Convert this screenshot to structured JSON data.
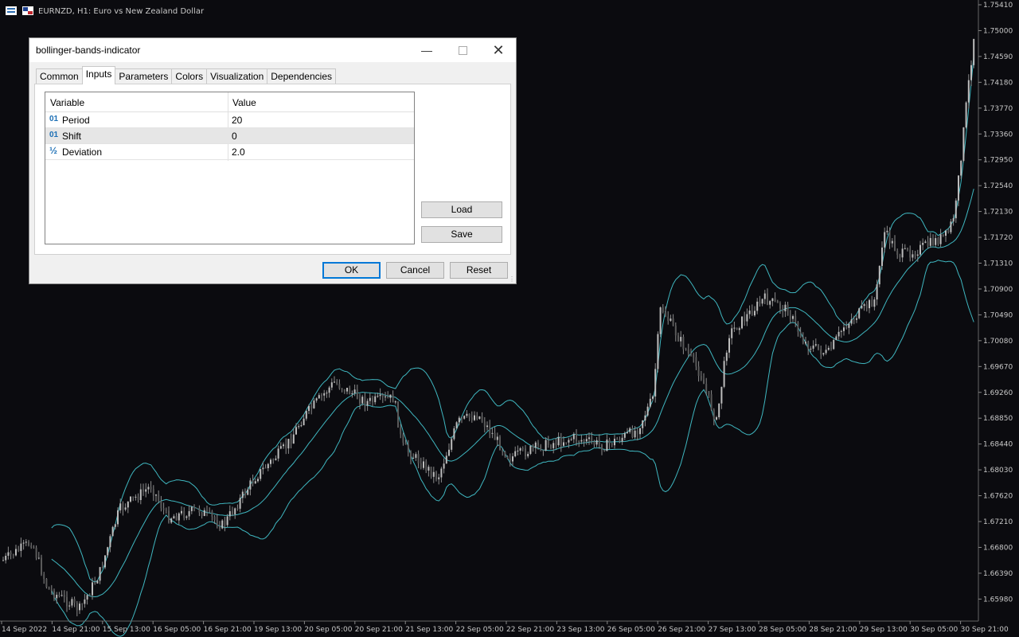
{
  "chart": {
    "title": "EURNZD, H1:  Euro vs New Zealand Dollar",
    "price_labels": [
      "1.75410",
      "1.75000",
      "1.74590",
      "1.74180",
      "1.73770",
      "1.73360",
      "1.72950",
      "1.72540",
      "1.72130",
      "1.71720",
      "1.71310",
      "1.70900",
      "1.70490",
      "1.70080",
      "1.69670",
      "1.69260",
      "1.68850",
      "1.68440",
      "1.68030",
      "1.67620",
      "1.67210",
      "1.66800",
      "1.66390",
      "1.65980"
    ],
    "time_labels": [
      "14 Sep 2022",
      "14 Sep 21:00",
      "15 Sep 13:00",
      "16 Sep 05:00",
      "16 Sep 21:00",
      "19 Sep 13:00",
      "20 Sep 05:00",
      "20 Sep 21:00",
      "21 Sep 13:00",
      "22 Sep 05:00",
      "22 Sep 21:00",
      "23 Sep 13:00",
      "26 Sep 05:00",
      "26 Sep 21:00",
      "27 Sep 13:00",
      "28 Sep 05:00",
      "28 Sep 21:00",
      "29 Sep 13:00",
      "30 Sep 05:00",
      "30 Sep 21:00"
    ],
    "colors": {
      "background": "#0b0b0f",
      "candle": "#8c8c8c",
      "bands": "#3fb7c0",
      "text": "#c8c8c8"
    }
  },
  "dialog": {
    "title": "bollinger-bands-indicator",
    "tabs": [
      {
        "label": "Common"
      },
      {
        "label": "Inputs"
      },
      {
        "label": "Parameters"
      },
      {
        "label": "Colors"
      },
      {
        "label": "Visualization"
      },
      {
        "label": "Dependencies"
      }
    ],
    "active_tab": "Inputs",
    "grid": {
      "headers": {
        "variable": "Variable",
        "value": "Value"
      },
      "rows": [
        {
          "icon": "01",
          "variable": "Period",
          "value": "20"
        },
        {
          "icon": "01",
          "variable": "Shift",
          "value": "0"
        },
        {
          "icon": "½",
          "variable": "Deviation",
          "value": "2.0"
        }
      ]
    },
    "load_label": "Load",
    "save_label": "Save",
    "ok_label": "OK",
    "cancel_label": "Cancel",
    "reset_label": "Reset"
  }
}
